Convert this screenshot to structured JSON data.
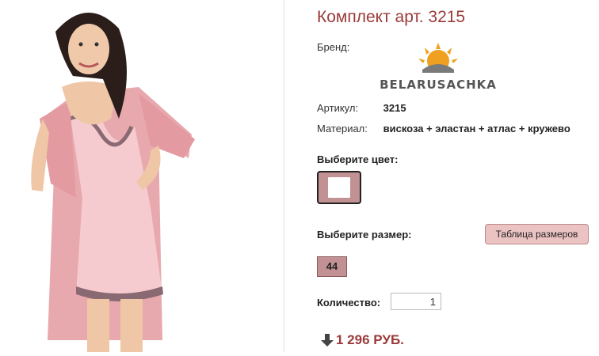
{
  "product": {
    "title": "Комплект арт. 3215",
    "brand_label": "Бренд:",
    "brand_name": "BELARUSACHKA",
    "article_label": "Артикул:",
    "article_value": "3215",
    "material_label": "Материал:",
    "material_value": "вискоза + эластан + атлас + кружево"
  },
  "color": {
    "label": "Выберите цвет:",
    "selected_swatch": "#c29193"
  },
  "size": {
    "label": "Выберите размер:",
    "table_button": "Таблица размеров",
    "options": [
      "44"
    ]
  },
  "quantity": {
    "label": "Количество:",
    "value": "1"
  },
  "price": {
    "text": "1 296 РУБ.",
    "icon": "down-arrow-icon"
  },
  "colors": {
    "accent": "#9b3a3a",
    "pink": "#ecc3c3",
    "mauve": "#c29193"
  }
}
